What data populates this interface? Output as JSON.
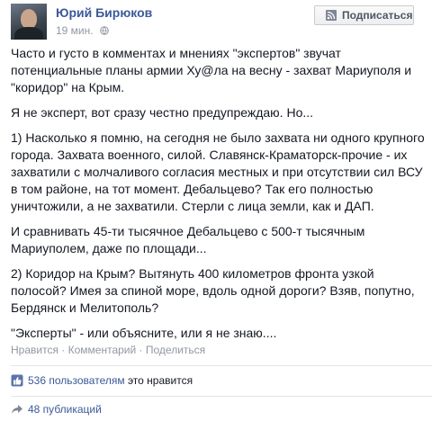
{
  "header": {
    "author": "Юрий Бирюков",
    "time": "19 мин.",
    "subscribe_label": "Подписаться"
  },
  "post": {
    "paragraphs": [
      "Часто и густо в комментах и мнениях \"экспертов\" звучат\nпотенциальные планы армии Ху@ла на весну - захват Мариуполя и\n\"коридор\" на Крым.",
      "Я не эксперт, вот сразу честно предупреждаю. Но...",
      "1) Насколько я помню, на сегодня не было захвата ни одного крупного\nгорода. Захвата военного, силой. Славянск-Краматорск-прочие - их\nзахватили с молчаливого согласия местных и при отсутствии сил ВСУ\nв том районе, на тот момент. Дебальцево? Так его полностью\nуничтожили, а не захватили. Стерли с лица земли, как и ДАП.",
      "И сравнивать 45-ти тысячное Дебальцево с 500-т тысячным\nМариуполем, даже по площади...",
      "2) Коридор на Крым? Вытянуть 400 километров фронта узкой\nполосой? Имея за спиной море, вдоль одной дороги? Взяв, попутно,\nБердянск и Мелитополь?",
      "\"Эксперты\" - или объясните, или я не знаю...."
    ]
  },
  "actions": {
    "like": "Нравится",
    "comment": "Комментарий",
    "share": "Поделиться",
    "separator": " · "
  },
  "likes": {
    "count_text": "536 пользователям",
    "suffix": " это нравится"
  },
  "shares": {
    "text": "48 публикаций"
  },
  "colors": {
    "link": "#3b5998",
    "muted": "#9197a3",
    "text": "#141823"
  }
}
